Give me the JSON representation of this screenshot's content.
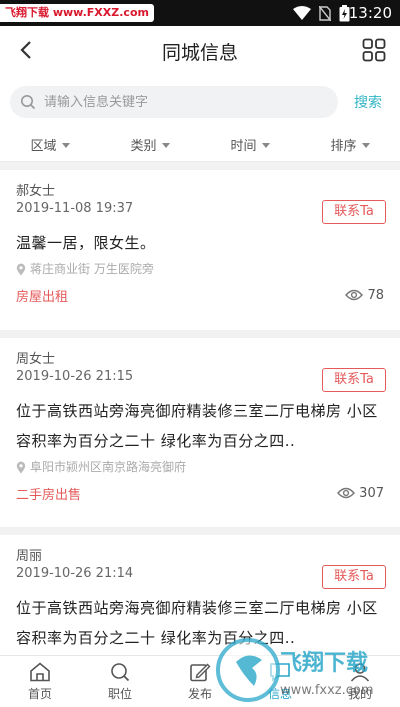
{
  "statusbar": {
    "watermark_text": "飞翔下载 www.FXXZ.com",
    "time": "13:20"
  },
  "navbar": {
    "title": "同城信息",
    "back_icon": "chevron-left-icon",
    "menu_icon": "grid-icon"
  },
  "search": {
    "placeholder": "请输入信息关键字",
    "value": "",
    "button_label": "搜索"
  },
  "filters": [
    {
      "label": "区域"
    },
    {
      "label": "类别"
    },
    {
      "label": "时间"
    },
    {
      "label": "排序"
    }
  ],
  "listings": [
    {
      "name": "郝女士",
      "date": "2019-11-08 19:37",
      "contact_label": "联系Ta",
      "description": "温馨一居，限女生。",
      "location": "蒋庄商业街 万生医院旁",
      "category": "房屋出租",
      "views": "78"
    },
    {
      "name": "周女士",
      "date": "2019-10-26 21:15",
      "contact_label": "联系Ta",
      "description": "位于高铁西站旁海亮御府精装修三室二厅电梯房  小区容积率为百分之二十   绿化率为百分之四..",
      "location": "阜阳市颍州区南京路海亮御府",
      "category": "二手房出售",
      "views": "307"
    },
    {
      "name": "周丽",
      "date": "2019-10-26 21:14",
      "contact_label": "联系Ta",
      "description": "位于高铁西站旁海亮御府精装修三室二厅电梯房  小区容积率为百分之二十   绿化率为百分之四..",
      "location": "",
      "category": "",
      "views": ""
    }
  ],
  "tabs": [
    {
      "label": "首页",
      "icon": "home-icon"
    },
    {
      "label": "职位",
      "icon": "search-icon"
    },
    {
      "label": "发布",
      "icon": "edit-icon"
    },
    {
      "label": "信息",
      "icon": "message-icon"
    },
    {
      "label": "我的",
      "icon": "user-icon"
    }
  ],
  "watermark": {
    "brand": "飞翔下载",
    "url": "www.fxxz.com"
  },
  "colors": {
    "accent": "#31b5c4",
    "contact": "#e45a5a"
  }
}
